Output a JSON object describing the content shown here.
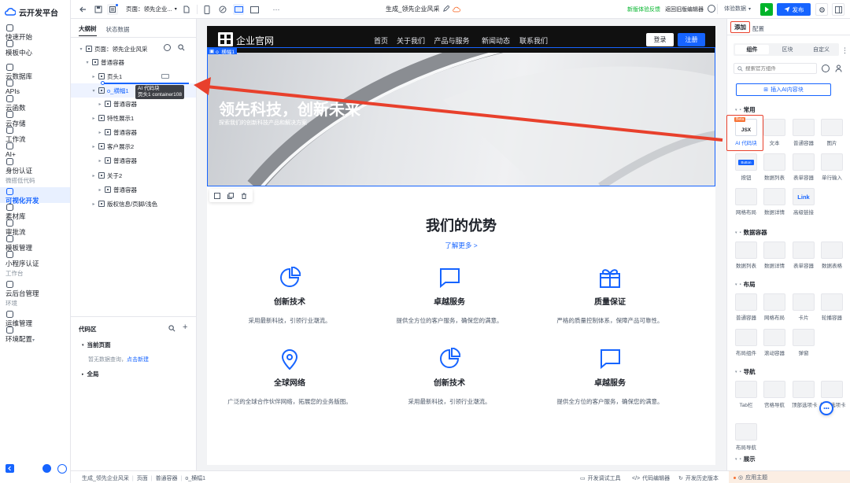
{
  "app": {
    "title": "云开发平台"
  },
  "sidebar": {
    "groups": [
      {
        "section": "",
        "items": [
          {
            "label": "快速开始",
            "icon": "flag-icon"
          },
          {
            "label": "模板中心",
            "icon": "template-icon"
          }
        ]
      },
      {
        "section": "",
        "items": [
          {
            "label": "云数据库",
            "icon": "database-icon"
          },
          {
            "label": "APIs",
            "icon": "api-icon"
          },
          {
            "label": "云函数",
            "icon": "function-icon"
          },
          {
            "label": "云存储",
            "icon": "storage-icon"
          },
          {
            "label": "工作流",
            "icon": "workflow-icon"
          },
          {
            "label": "AI+",
            "icon": "ai-icon"
          },
          {
            "label": "身份认证",
            "icon": "id-icon"
          }
        ]
      },
      {
        "section": "微搭低代码",
        "items": [
          {
            "label": "可视化开发",
            "icon": "visual-dev-icon",
            "active": true
          },
          {
            "label": "素材库",
            "icon": "material-icon"
          },
          {
            "label": "审批流",
            "icon": "approval-icon"
          },
          {
            "label": "模板管理",
            "icon": "template-manage-icon"
          },
          {
            "label": "小程序认证",
            "icon": "miniapp-icon"
          }
        ]
      },
      {
        "section": "工作台",
        "items": [
          {
            "label": "云后台管理",
            "icon": "admin-icon"
          }
        ]
      },
      {
        "section": "环境",
        "items": [
          {
            "label": "运维管理",
            "icon": "ops-icon"
          },
          {
            "label": "环境配置",
            "icon": "env-icon"
          }
        ]
      }
    ]
  },
  "topbar": {
    "page_label": "页面：",
    "page_value": "领先企业...",
    "center_title": "生成_领先企业风采",
    "feedback": "新版体验反馈",
    "return_old": "返回旧版编辑器",
    "env_select": "体验数据",
    "publish": "发布",
    "more_label": "···"
  },
  "outline": {
    "tabs": [
      "大纲树",
      "状态数据"
    ],
    "rows": [
      {
        "label": "页面：领先企业风采",
        "indent": 0
      },
      {
        "label": "普通容器",
        "indent": 1
      },
      {
        "label": "页头1",
        "indent": 2
      },
      {
        "label": "o_横幅1",
        "indent": 2,
        "selected": true
      },
      {
        "label": "普通容器",
        "indent": 3
      },
      {
        "label": "特性展示1",
        "indent": 2
      },
      {
        "label": "普通容器",
        "indent": 3
      },
      {
        "label": "客户展示2",
        "indent": 2
      },
      {
        "label": "普通容器",
        "indent": 3
      },
      {
        "label": "关于2",
        "indent": 2
      },
      {
        "label": "普通容器",
        "indent": 3
      },
      {
        "label": "版权信息/页脚/浅色",
        "indent": 2
      }
    ],
    "drag_tooltip_title": "AI 代码块",
    "drag_tooltip_sub": "页头1 container108"
  },
  "codearea": {
    "title": "代码区",
    "current_page": "当前页面",
    "empty_text": "暂无数据查询，",
    "create_link": "点击新建",
    "global": "全局"
  },
  "site": {
    "logo_text": "企业官网",
    "nav": [
      "首页",
      "关于我们",
      "产品与服务",
      "新闻动态",
      "联系我们"
    ],
    "login": "登录",
    "register": "注册",
    "banner_tag": "o_横幅1",
    "hero_title": "领先科技，创新未来",
    "hero_sub": "探索我们的创新科技产品和解决方案",
    "section_title": "我们的优势",
    "learn_more": "了解更多 >",
    "features": [
      {
        "title": "创新技术",
        "desc": "采用最新科技，引领行业潮流。",
        "icon": "pie-chart-icon"
      },
      {
        "title": "卓越服务",
        "desc": "提供全方位的客户服务，确保您的满意。",
        "icon": "chat-icon"
      },
      {
        "title": "质量保证",
        "desc": "严格的质量控制体系，保障产品可靠性。",
        "icon": "gift-box-icon"
      },
      {
        "title": "全球网络",
        "desc": "广泛的全球合作伙伴网络，拓展您的业务版图。",
        "icon": "location-pin-icon"
      },
      {
        "title": "创新技术",
        "desc": "采用最新科技，引领行业潮流。",
        "icon": "pie-chart-icon"
      },
      {
        "title": "卓越服务",
        "desc": "提供全方位的客户服务，确保您的满意。",
        "icon": "chat-icon"
      }
    ]
  },
  "rightpanel": {
    "tabs": [
      "添加",
      "配置"
    ],
    "subtabs": [
      "组件",
      "区块",
      "自定义"
    ],
    "search_placeholder": "搜索官方组件",
    "ai_button": "插入AI内容块",
    "sections": [
      {
        "title": "常用",
        "items": [
          "AI 代码块",
          "文本",
          "普通容器",
          "图片",
          "按钮",
          "数据列表",
          "表单容器",
          "单行输入",
          "网格布局",
          "数据详情",
          "高级链接"
        ]
      },
      {
        "title": "数据容器",
        "items": [
          "数据列表",
          "数据详情",
          "表单容器",
          "数据表格"
        ]
      },
      {
        "title": "布局",
        "items": [
          "普通容器",
          "网格布局",
          "卡片",
          "轮播容器",
          "布局组件",
          "滚动容器",
          "弹窗"
        ]
      },
      {
        "title": "导航",
        "items": [
          "Tab栏",
          "宫格导航",
          "顶部选项卡",
          "侧边选项卡",
          "布局导航"
        ]
      },
      {
        "title": "展示",
        "items": []
      }
    ],
    "beta_tag": "Beta",
    "jsx_label": "JSX",
    "button_thumb": "Button",
    "link_thumb": "Link"
  },
  "statusbar": {
    "breadcrumb": [
      "生成_领先企业风采",
      "页面",
      "普通容器",
      "o_横幅1"
    ],
    "debug": "开发调试工具",
    "code_editor": "代码编辑器",
    "history": "开发历史版本",
    "theme": "应用主题"
  },
  "colors": {
    "accent": "#1664ff",
    "green": "#00b42a",
    "red": "#e8402c"
  }
}
